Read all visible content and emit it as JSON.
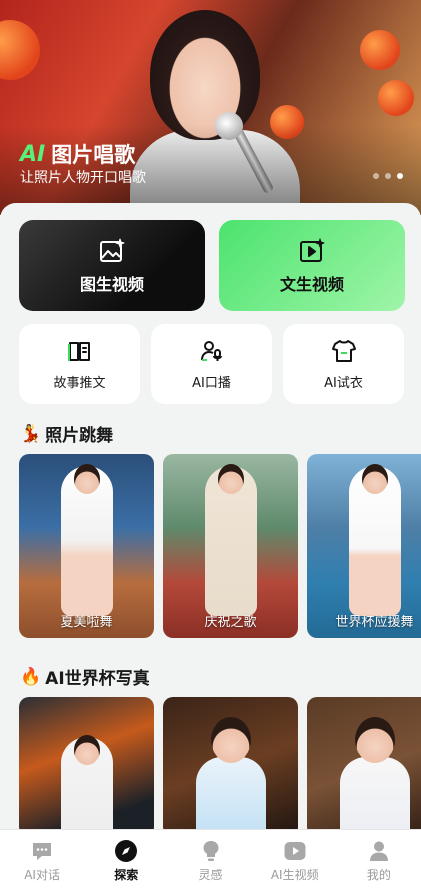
{
  "banner": {
    "title_ai": "AI",
    "title_rest": "图片唱歌",
    "subtitle": "让照片人物开口唱歌",
    "dots_count": 3,
    "active_dot": 3
  },
  "features": {
    "primary": [
      {
        "label": "图生视频",
        "icon": "image-sparkle-icon"
      },
      {
        "label": "文生视频",
        "icon": "video-sparkle-icon"
      }
    ],
    "secondary": [
      {
        "label": "故事推文",
        "icon": "book-icon"
      },
      {
        "label": "AI口播",
        "icon": "person-mic-icon"
      },
      {
        "label": "AI试衣",
        "icon": "shirt-icon"
      }
    ]
  },
  "section_dance": {
    "emoji": "💃",
    "title": "照片跳舞",
    "items": [
      {
        "caption": "夏美啦舞"
      },
      {
        "caption": "庆祝之歌"
      },
      {
        "caption": "世界杯应援舞"
      }
    ]
  },
  "section_worldcup": {
    "emoji": "🔥",
    "title": "AI世界杯写真"
  },
  "tabbar": {
    "items": [
      {
        "label": "AI对话",
        "icon": "chat-bubble-icon"
      },
      {
        "label": "探索",
        "icon": "compass-icon"
      },
      {
        "label": "灵感",
        "icon": "lightbulb-icon"
      },
      {
        "label": "AI生视频",
        "icon": "play-icon"
      },
      {
        "label": "我的",
        "icon": "person-icon"
      }
    ],
    "active_index": 1
  },
  "colors": {
    "accent_green": "#4ce36e",
    "dark_card": "#0d0d0d",
    "background": "#f2f4f3"
  }
}
